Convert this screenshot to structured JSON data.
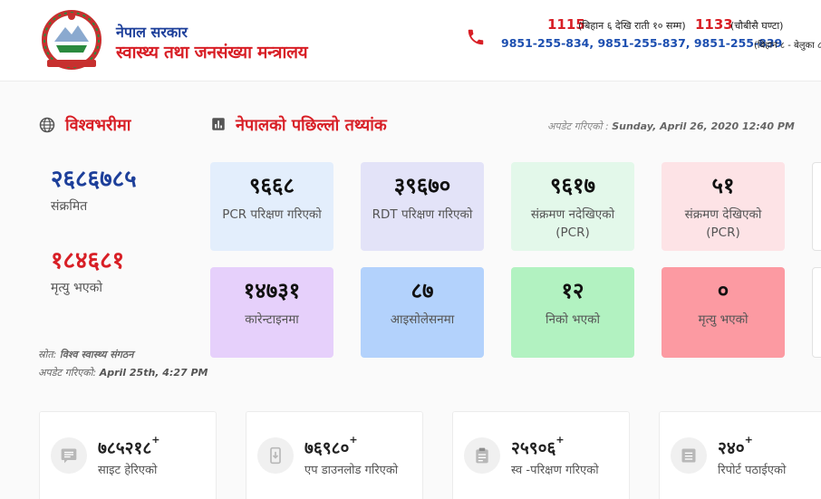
{
  "header": {
    "gov_name": "नेपाल सरकार",
    "ministry": "स्वास्थ्य तथा जनसंख्या मन्त्रालय",
    "hotline1": "1115",
    "hotline1_note": "(बिहान ६ देखि राती १० सम्म)",
    "hotline2": "1133",
    "hotline2_note": "(चौबीसै घण्टा)",
    "phones": "9851-255-834,  9851-255-837,  9851-255-839",
    "phones_note": "(बिहान ८ - बेलुका ८"
  },
  "world": {
    "title": "विश्वभरीमा",
    "infected": "२६८६७८५",
    "infected_label": "संक्रमित",
    "deaths": "१८४६८१",
    "deaths_label": "मृत्यु भएको",
    "source_label": "स्रोत:",
    "source_value": "विश्व स्वास्थ्य संगठन",
    "updated_label": "अपडेट गरिएको:",
    "updated_value": "April 25th, 4:27 PM"
  },
  "nepal": {
    "title": "नेपालको पछिल्लो तथ्यांक",
    "updated_label": "अपडेट गरिएको :",
    "updated_value": "Sunday, April 26, 2020 12:40 PM",
    "cards": [
      {
        "value": "९६६८",
        "label": "PCR परिक्षण गरिएको"
      },
      {
        "value": "३९६७०",
        "label": "RDT परिक्षण गरिएको"
      },
      {
        "value": "९६१७",
        "label": "संक्रमण नदेखिएको (PCR)"
      },
      {
        "value": "५१",
        "label": "संक्रमण देखिएको (PCR)"
      },
      {
        "value": "१४७३१",
        "label": "कारेन्टाइनमा"
      },
      {
        "value": "८७",
        "label": "आइसोलेसनमा"
      },
      {
        "value": "१२",
        "label": "निको भएको"
      },
      {
        "value": "०",
        "label": "मृत्यु भएको"
      }
    ]
  },
  "stats": [
    {
      "value": "७८५२१८",
      "plus": "+",
      "label": "साइट हेरिएको",
      "icon": "message-icon"
    },
    {
      "value": "७६९८०",
      "plus": "+",
      "label": "एप डाउनलोड गरिएको",
      "icon": "download-app-icon"
    },
    {
      "value": "२५९०६",
      "plus": "+",
      "label": "स्व -परिक्षण गरिएको",
      "icon": "clipboard-icon"
    },
    {
      "value": "२४०",
      "plus": "+",
      "label": "रिपोर्ट पठाईएको",
      "icon": "report-icon"
    }
  ],
  "colors": {
    "accent_red": "#d81f26",
    "accent_blue": "#1d3f9a"
  }
}
